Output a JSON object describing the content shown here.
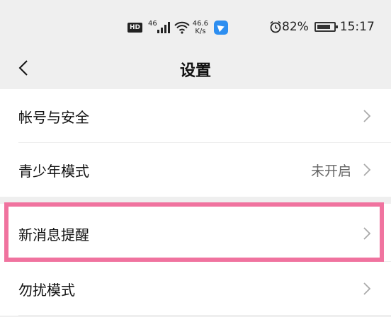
{
  "status_bar": {
    "hd_badge": "HD",
    "signal_label": "46",
    "speed_value": "46.6",
    "speed_unit": "K/s",
    "battery_percent": "82%",
    "time": "15:17"
  },
  "header": {
    "title": "设置"
  },
  "settings": {
    "items": [
      {
        "label": "帐号与安全",
        "value": ""
      },
      {
        "label": "青少年模式",
        "value": "未开启"
      },
      {
        "label": "新消息提醒",
        "value": ""
      },
      {
        "label": "勿扰模式",
        "value": ""
      }
    ]
  },
  "colors": {
    "background": "#efefef",
    "highlight": "#f0739f",
    "app_badge": "#2d8ef0"
  }
}
